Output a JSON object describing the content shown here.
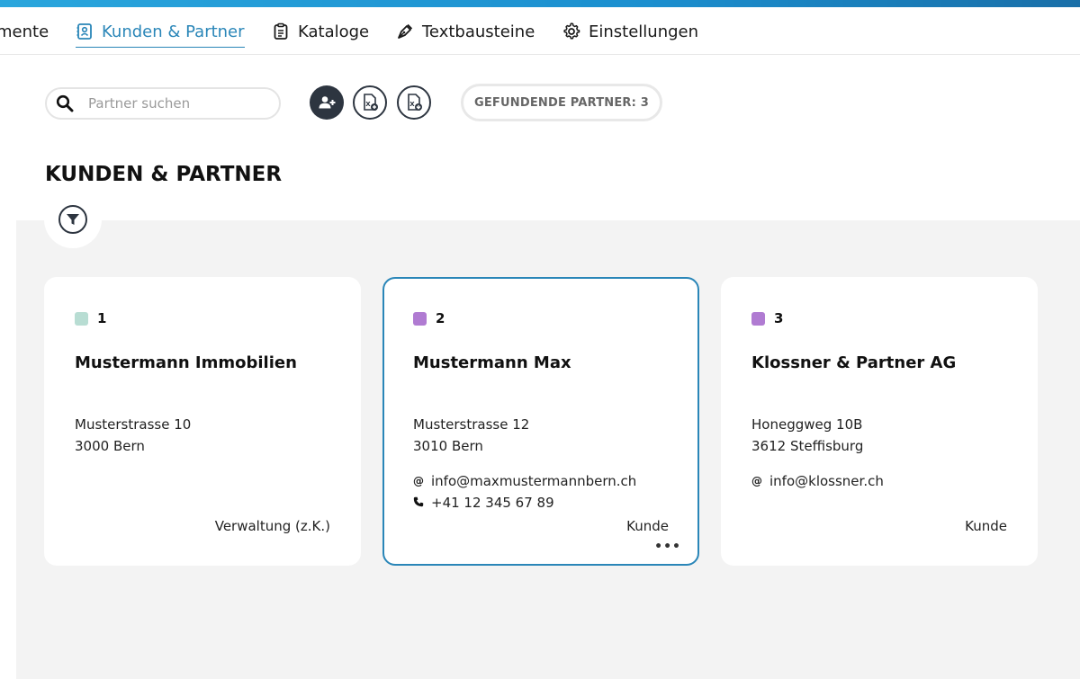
{
  "nav": {
    "items": [
      {
        "label": "mente",
        "icon": "document-icon"
      },
      {
        "label": "Kunden & Partner",
        "icon": "contact-book-icon",
        "active": true
      },
      {
        "label": "Kataloge",
        "icon": "clipboard-icon"
      },
      {
        "label": "Textbausteine",
        "icon": "pen-icon"
      },
      {
        "label": "Einstellungen",
        "icon": "gear-icon"
      }
    ]
  },
  "search": {
    "placeholder": "Partner suchen",
    "value": ""
  },
  "toolbar": {
    "add_partner_icon": "add-user-icon",
    "import_excel_icon": "excel-import-icon",
    "export_excel_icon": "excel-export-icon"
  },
  "count": {
    "label": "GEFUNDENDE PARTNER: 3"
  },
  "page": {
    "title": "KUNDEN & PARTNER"
  },
  "colors": {
    "accent": "#2a86b8",
    "dark_button": "#2d3540",
    "content_bg": "#f3f3f3",
    "dot_teal": "#b8ddd3",
    "dot_purple": "#b07bd2"
  },
  "cards": [
    {
      "id": "1",
      "dot_color": "#b8ddd3",
      "name": "Mustermann Immobilien",
      "street": "Musterstrasse 10",
      "city": "3000 Bern",
      "email": "",
      "phone": "",
      "role": "Verwaltung (z.K.)"
    },
    {
      "id": "2",
      "dot_color": "#b07bd2",
      "name": "Mustermann Max",
      "street": "Musterstrasse 12",
      "city": "3010 Bern",
      "email": "info@maxmustermannbern.ch",
      "phone": "+41 12 345 67 89",
      "role": "Kunde",
      "selected": true
    },
    {
      "id": "3",
      "dot_color": "#b07bd2",
      "name": "Klossner & Partner AG",
      "street": "Honeggweg 10B",
      "city": "3612 Steffisburg",
      "email": "info@klossner.ch",
      "phone": "",
      "role": "Kunde"
    }
  ]
}
